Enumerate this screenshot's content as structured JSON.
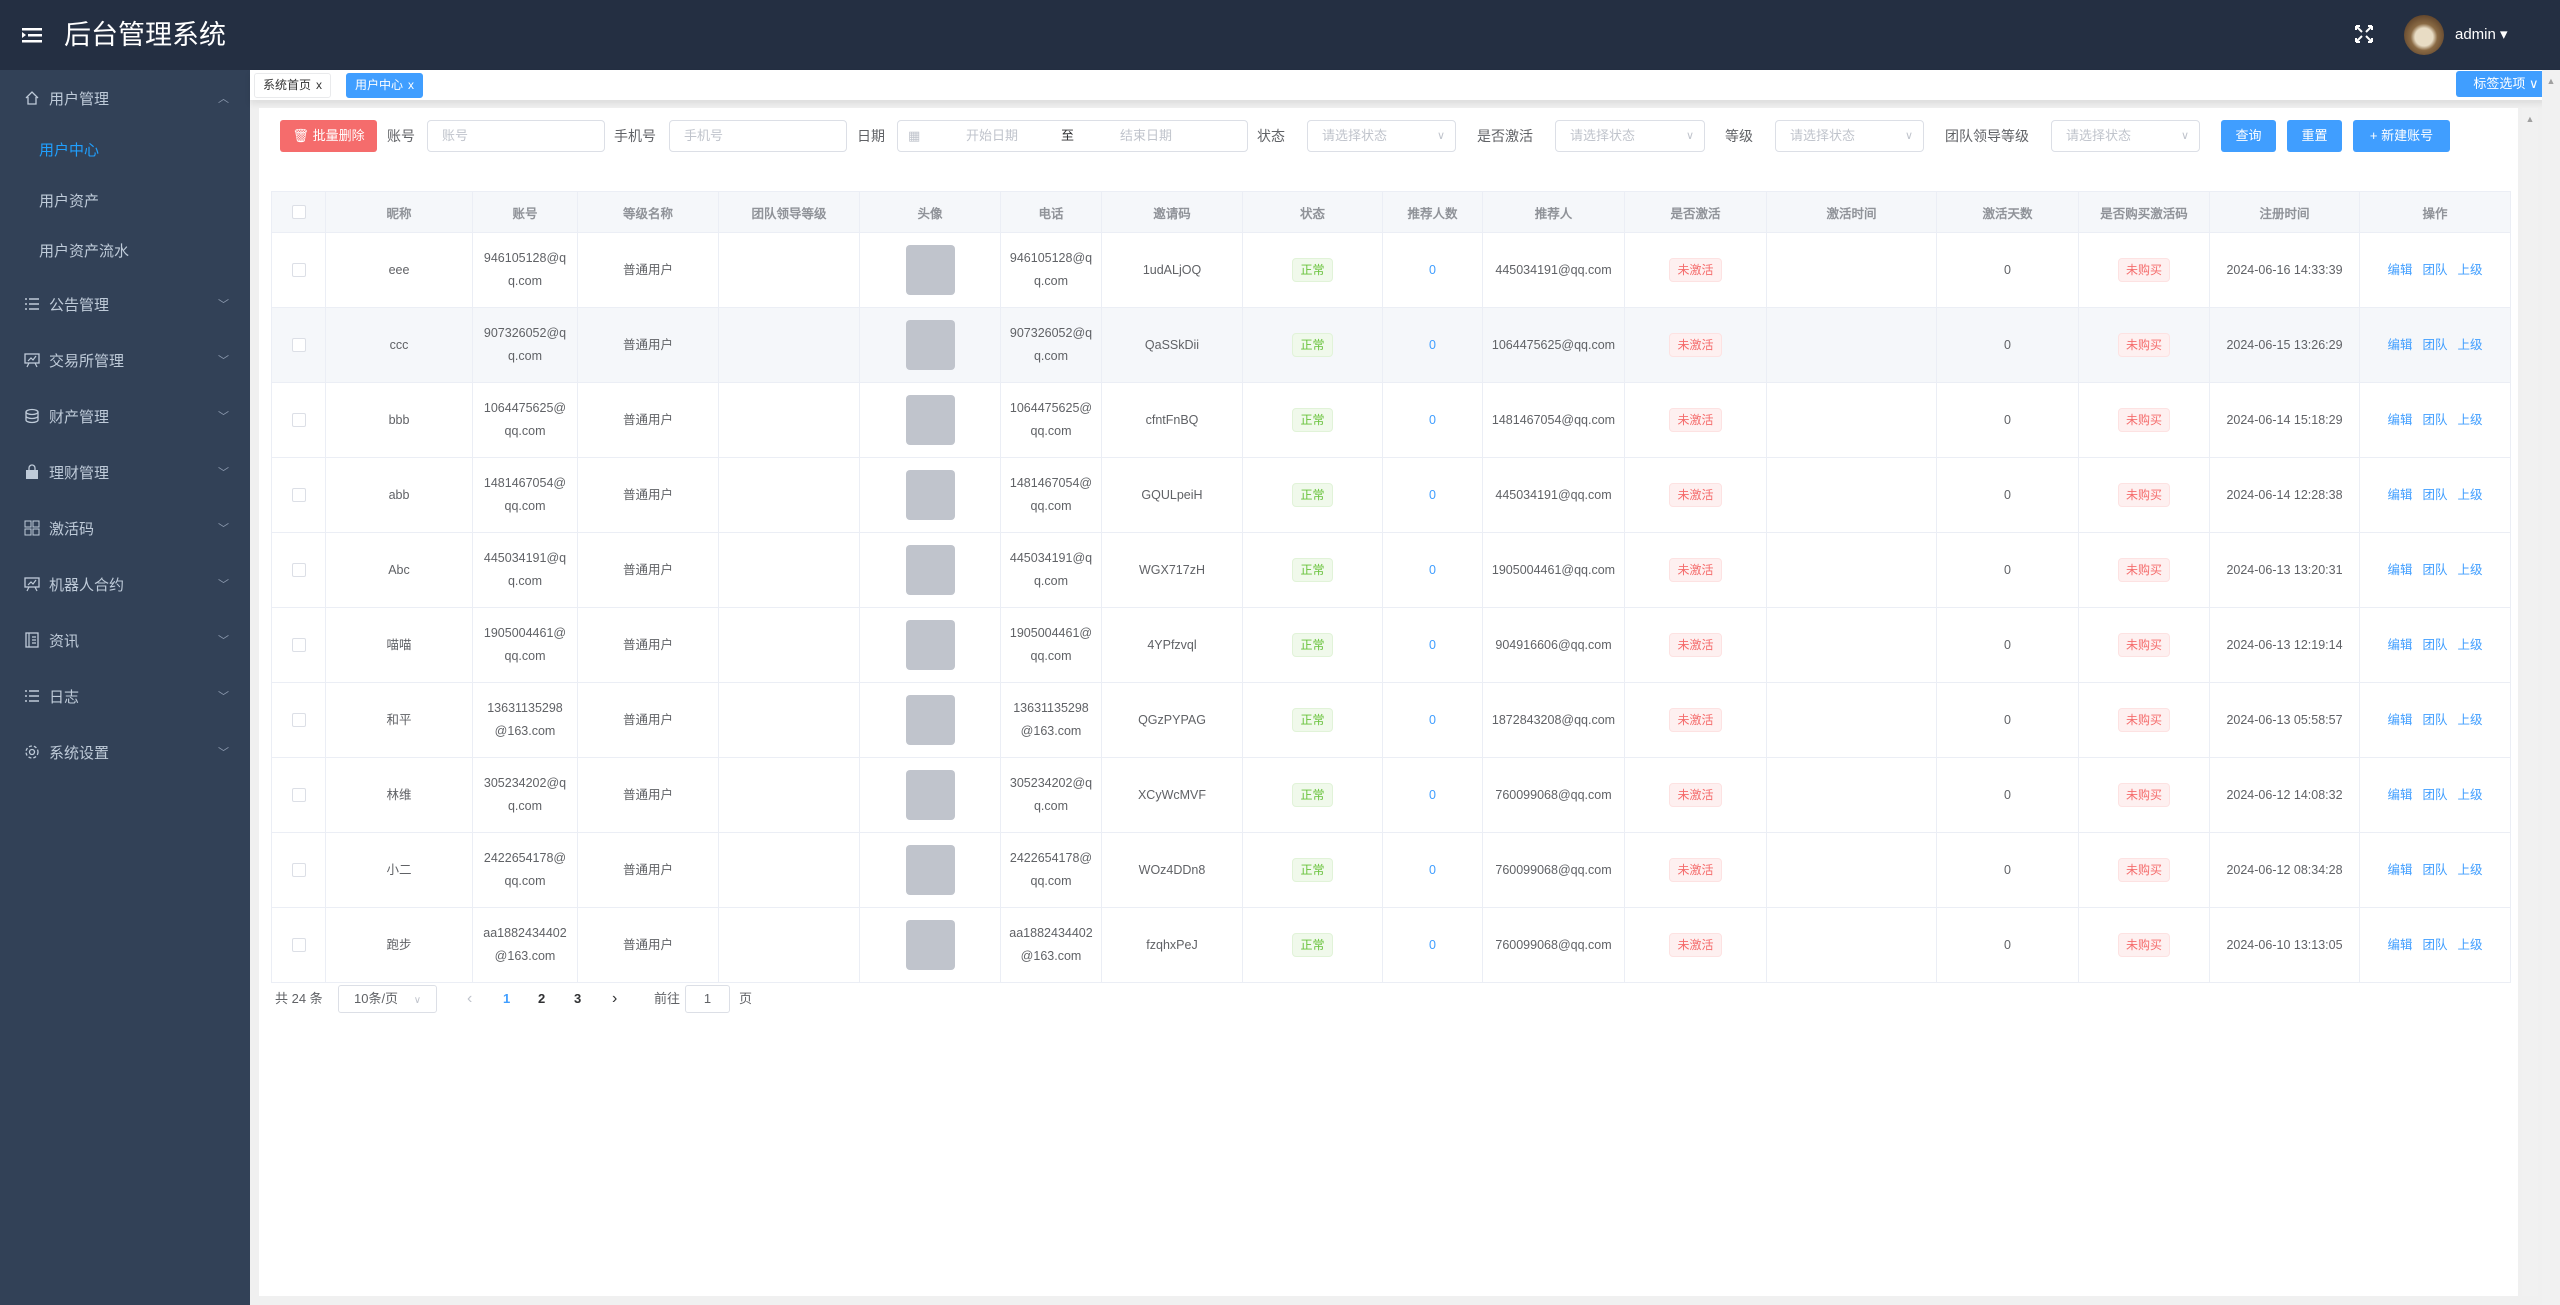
{
  "header": {
    "title": "后台管理系统",
    "user": "admin ▾",
    "menu_icon": "hamburger-icon",
    "fullscreen_icon": "fullscreen-icon"
  },
  "sidebar": {
    "groups": [
      {
        "label": "用户管理",
        "icon": "home-icon",
        "expanded": true,
        "children": [
          {
            "label": "用户中心",
            "active": true
          },
          {
            "label": "用户资产"
          },
          {
            "label": "用户资产流水"
          }
        ]
      },
      {
        "label": "公告管理",
        "icon": "list-icon"
      },
      {
        "label": "交易所管理",
        "icon": "presentation-chart-icon"
      },
      {
        "label": "财产管理",
        "icon": "database-icon"
      },
      {
        "label": "理财管理",
        "icon": "shopping-bag-icon"
      },
      {
        "label": "激活码",
        "icon": "grid-icon"
      },
      {
        "label": "机器人合约",
        "icon": "presentation-chart-icon"
      },
      {
        "label": "资讯",
        "icon": "notebook-icon"
      },
      {
        "label": "日志",
        "icon": "list-icon"
      },
      {
        "label": "系统设置",
        "icon": "gear-icon"
      }
    ]
  },
  "tabs": [
    {
      "label": "系统首页",
      "close": "x"
    },
    {
      "label": "用户中心",
      "close": "x",
      "active": true
    }
  ],
  "tag_options": "标签选项 ∨",
  "filters": {
    "batch_delete": "批量删除",
    "account_label": "账号",
    "account_placeholder": "账号",
    "phone_label": "手机号",
    "phone_placeholder": "手机号",
    "date_label": "日期",
    "date_start": "开始日期",
    "date_sep": "至",
    "date_end": "结束日期",
    "status_label": "状态",
    "status_placeholder": "请选择状态",
    "activated_label": "是否激活",
    "activated_placeholder": "请选择状态",
    "level_label": "等级",
    "level_placeholder": "请选择状态",
    "team_level_label": "团队领导等级",
    "team_level_placeholder": "请选择状态",
    "query": "查询",
    "reset": "重置",
    "create": "+ 新建账号"
  },
  "table": {
    "columns": [
      "",
      "昵称",
      "账号",
      "等级名称",
      "团队领导等级",
      "头像",
      "电话",
      "邀请码",
      "状态",
      "推荐人数",
      "推荐人",
      "是否激活",
      "激活时间",
      "激活天数",
      "是否购买激活码",
      "注册时间",
      "操作"
    ],
    "actions": [
      "编辑",
      "团队",
      "上级"
    ],
    "rows": [
      {
        "nickname": "eee",
        "account": "946105128@qq.com",
        "level": "普通用户",
        "team_level": "",
        "phone": "946105128@qq.com",
        "invite": "1udALjOQ",
        "status": "正常",
        "ref_count": "0",
        "referrer": "445034191@qq.com",
        "activated": "未激活",
        "act_time": "",
        "act_days": "0",
        "purchased": "未购买",
        "registered": "2024-06-16 14:33:39"
      },
      {
        "nickname": "ccc",
        "account": "907326052@qq.com",
        "level": "普通用户",
        "team_level": "",
        "phone": "907326052@qq.com",
        "invite": "QaSSkDii",
        "status": "正常",
        "ref_count": "0",
        "referrer": "1064475625@qq.com",
        "activated": "未激活",
        "act_time": "",
        "act_days": "0",
        "purchased": "未购买",
        "registered": "2024-06-15 13:26:29"
      },
      {
        "nickname": "bbb",
        "account": "1064475625@qq.com",
        "level": "普通用户",
        "team_level": "",
        "phone": "1064475625@qq.com",
        "invite": "cfntFnBQ",
        "status": "正常",
        "ref_count": "0",
        "referrer": "1481467054@qq.com",
        "activated": "未激活",
        "act_time": "",
        "act_days": "0",
        "purchased": "未购买",
        "registered": "2024-06-14 15:18:29"
      },
      {
        "nickname": "abb",
        "account": "1481467054@qq.com",
        "level": "普通用户",
        "team_level": "",
        "phone": "1481467054@qq.com",
        "invite": "GQULpeiH",
        "status": "正常",
        "ref_count": "0",
        "referrer": "445034191@qq.com",
        "activated": "未激活",
        "act_time": "",
        "act_days": "0",
        "purchased": "未购买",
        "registered": "2024-06-14 12:28:38"
      },
      {
        "nickname": "Abc",
        "account": "445034191@qq.com",
        "level": "普通用户",
        "team_level": "",
        "phone": "445034191@qq.com",
        "invite": "WGX717zH",
        "status": "正常",
        "ref_count": "0",
        "referrer": "1905004461@qq.com",
        "activated": "未激活",
        "act_time": "",
        "act_days": "0",
        "purchased": "未购买",
        "registered": "2024-06-13 13:20:31"
      },
      {
        "nickname": "喵喵",
        "account": "1905004461@qq.com",
        "level": "普通用户",
        "team_level": "",
        "phone": "1905004461@qq.com",
        "invite": "4YPfzvql",
        "status": "正常",
        "ref_count": "0",
        "referrer": "904916606@qq.com",
        "activated": "未激活",
        "act_time": "",
        "act_days": "0",
        "purchased": "未购买",
        "registered": "2024-06-13 12:19:14"
      },
      {
        "nickname": "和平",
        "account": "13631135298@163.com",
        "level": "普通用户",
        "team_level": "",
        "phone": "13631135298@163.com",
        "invite": "QGzPYPAG",
        "status": "正常",
        "ref_count": "0",
        "referrer": "1872843208@qq.com",
        "activated": "未激活",
        "act_time": "",
        "act_days": "0",
        "purchased": "未购买",
        "registered": "2024-06-13 05:58:57"
      },
      {
        "nickname": "林维",
        "account": "305234202@qq.com",
        "level": "普通用户",
        "team_level": "",
        "phone": "305234202@qq.com",
        "invite": "XCyWcMVF",
        "status": "正常",
        "ref_count": "0",
        "referrer": "760099068@qq.com",
        "activated": "未激活",
        "act_time": "",
        "act_days": "0",
        "purchased": "未购买",
        "registered": "2024-06-12 14:08:32"
      },
      {
        "nickname": "小二",
        "account": "2422654178@qq.com",
        "level": "普通用户",
        "team_level": "",
        "phone": "2422654178@qq.com",
        "invite": "WOz4DDn8",
        "status": "正常",
        "ref_count": "0",
        "referrer": "760099068@qq.com",
        "activated": "未激活",
        "act_time": "",
        "act_days": "0",
        "purchased": "未购买",
        "registered": "2024-06-12 08:34:28"
      },
      {
        "nickname": "跑步",
        "account": "aa1882434402@163.com",
        "level": "普通用户",
        "team_level": "",
        "phone": "aa1882434402@163.com",
        "invite": "fzqhxPeJ",
        "status": "正常",
        "ref_count": "0",
        "referrer": "760099068@qq.com",
        "activated": "未激活",
        "act_time": "",
        "act_days": "0",
        "purchased": "未购买",
        "registered": "2024-06-10 13:13:05"
      }
    ]
  },
  "pagination": {
    "total": "共 24 条",
    "page_size": "10条/页",
    "pages": [
      "1",
      "2",
      "3"
    ],
    "current": "1",
    "prev": "‹",
    "next": "›",
    "goto_label": "前往",
    "goto_value": "1",
    "goto_suffix": "页"
  },
  "colors": {
    "header": "#242f42",
    "sidebar": "#324157",
    "accent": "#409eff",
    "danger": "#f56c6c",
    "success": "#67c23a"
  }
}
